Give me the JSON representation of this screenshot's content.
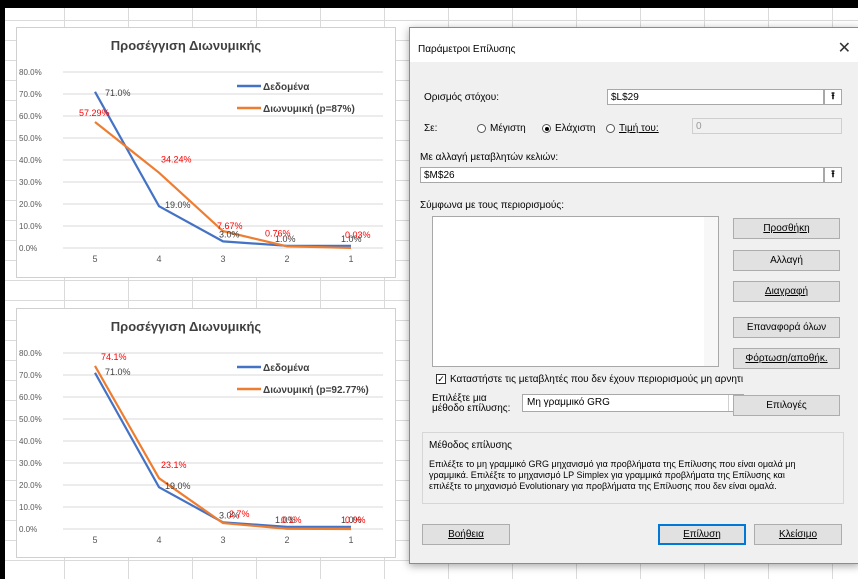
{
  "chart_data": [
    {
      "type": "line",
      "title": "Προσέγγιση Διωνυμικής",
      "categories": [
        "5",
        "4",
        "3",
        "2",
        "1"
      ],
      "yticks": [
        "80.0%",
        "70.0%",
        "60.0%",
        "50.0%",
        "40.0%",
        "30.0%",
        "20.0%",
        "10.0%",
        "0.0%"
      ],
      "ylim": [
        0,
        80
      ],
      "legend_position": "top-right",
      "series": [
        {
          "name": "Δεδομένα",
          "values": [
            71.0,
            19.0,
            3.0,
            1.0,
            1.0
          ],
          "labels": [
            "71.0%",
            "19.0%",
            "3.0%",
            "1.0%",
            "1.0%"
          ],
          "color": "#4472c4"
        },
        {
          "name": "Διωνυμική (p=87%)",
          "values": [
            57.29,
            34.24,
            7.67,
            0.76,
            0.03
          ],
          "labels": [
            "57.29%",
            "34.24%",
            "7.67%",
            "0.76%",
            "0.03%"
          ],
          "color": "#ed7d31",
          "label_color": "#ff0000"
        }
      ]
    },
    {
      "type": "line",
      "title": "Προσέγγιση Διωνυμικής",
      "categories": [
        "5",
        "4",
        "3",
        "2",
        "1"
      ],
      "yticks": [
        "80.0%",
        "70.0%",
        "60.0%",
        "50.0%",
        "40.0%",
        "30.0%",
        "20.0%",
        "10.0%",
        "0.0%"
      ],
      "ylim": [
        0,
        80
      ],
      "legend_position": "top-right",
      "series": [
        {
          "name": "Δεδομένα",
          "values": [
            71.0,
            19.0,
            3.0,
            1.0,
            1.0
          ],
          "labels": [
            "71.0%",
            "19.0%",
            "3.0%",
            "1.0%",
            "1.0%"
          ],
          "color": "#4472c4"
        },
        {
          "name": "Διωνυμική (p=92.77%)",
          "values": [
            74.1,
            23.1,
            2.7,
            0.1,
            0.0
          ],
          "labels": [
            "74.1%",
            "23.1%",
            "2.7%",
            "0.1%",
            "0.0%"
          ],
          "color": "#ed7d31",
          "label_color": "#ff0000"
        }
      ]
    }
  ],
  "dialog": {
    "title": "Παράμετροι Επίλυσης",
    "close_glyph": "✕",
    "objective_label": "Ορισμός στόχου:",
    "objective_value": "$L$29",
    "to_label": "Σε:",
    "opt_max": "Μέγιστη",
    "opt_min": "Ελάχιστη",
    "opt_value": "Τιμή του:",
    "value_of": "0",
    "changing_label": "Με αλλαγή μεταβλητών κελιών:",
    "changing_value": "$M$26",
    "constraints_label": "Σύμφωνα με τους περιορισμούς:",
    "btn_add": "Προσθήκη",
    "btn_change": "Αλλαγή",
    "btn_delete": "Διαγραφή",
    "btn_reset": "Επαναφορά όλων",
    "btn_load": "Φόρτωση/αποθήκ.",
    "nonneg_label": "Καταστήστε τις μεταβλητές που δεν έχουν περιορισμούς μη αρνητι",
    "method_label_1": "Επιλέξτε μια",
    "method_label_2": "μέθοδο επίλυσης:",
    "method_value": "Μη γραμμικό GRG",
    "btn_options": "Επιλογές",
    "group_title": "Μέθοδος επίλυσης",
    "desc_1": "Επιλέξτε το μη γραμμικό GRG μηχανισμό για προβλήματα της Επίλυσης που είναι ομαλά μη",
    "desc_2": "γραμμικά. Επιλέξτε το μηχανισμό LP Simplex για γραμμικά προβλήματα της Επίλυσης και",
    "desc_3": "επιλέξτε το μηχανισμό Evolutionary για προβλήματα της Επίλυσης που δεν είναι ομαλά.",
    "btn_help": "Βοήθεια",
    "btn_solve": "Επίλυση",
    "btn_close": "Κλείσιμο",
    "ref_icon": "collapse-dialog-icon",
    "ref_glyph": "⭱",
    "check_glyph": "✓",
    "dropdown_glyph": "▾"
  }
}
